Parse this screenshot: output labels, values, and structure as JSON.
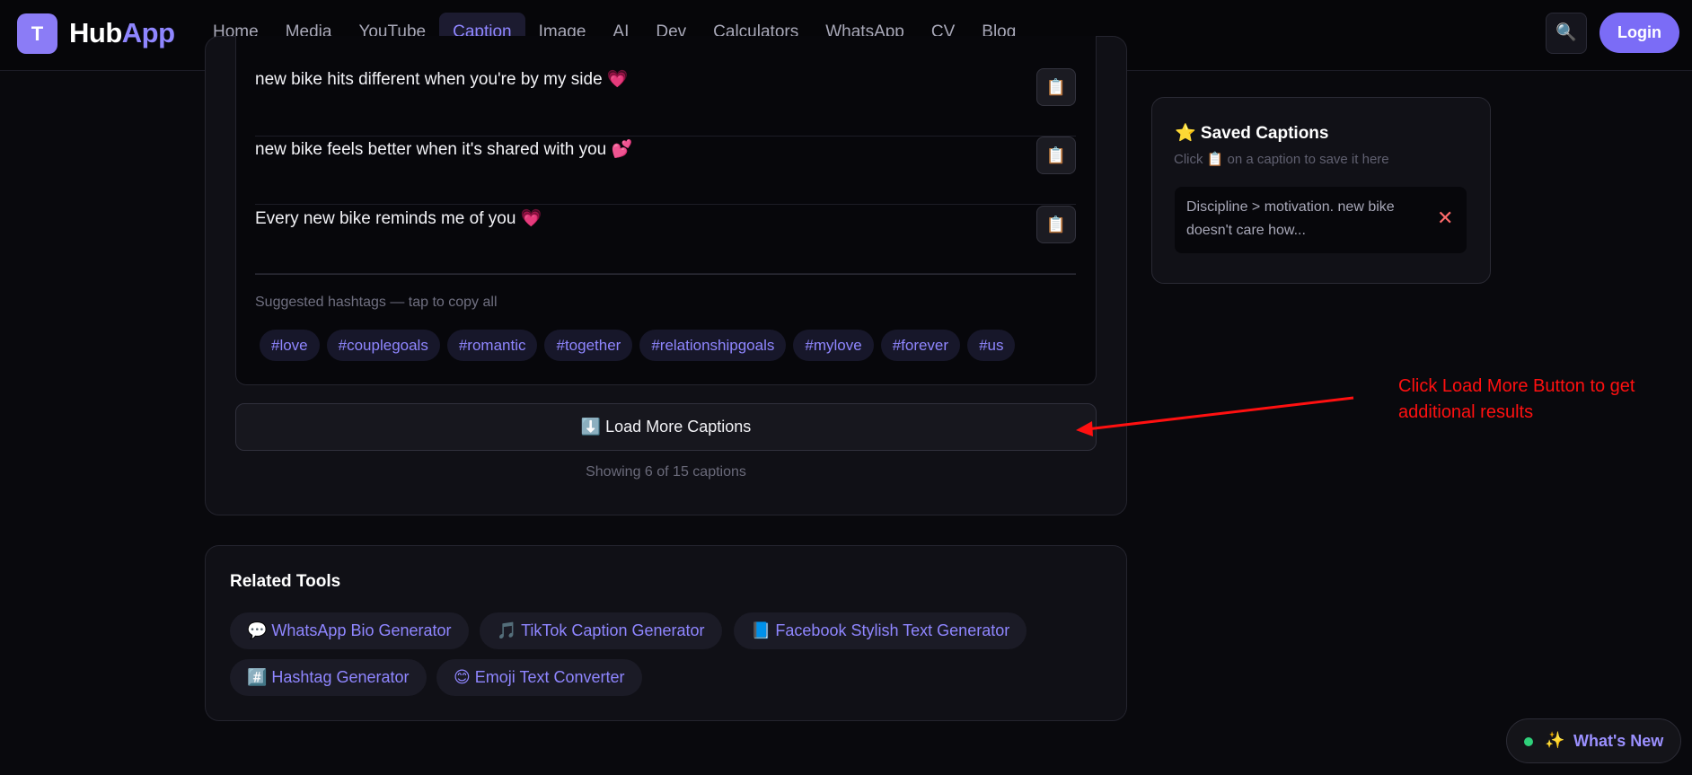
{
  "header": {
    "logo_letter": "T",
    "logo_hub": "Hub",
    "logo_app": "App",
    "nav": [
      "Home",
      "Media",
      "YouTube",
      "Caption",
      "Image",
      "AI",
      "Dev",
      "Calculators",
      "WhatsApp",
      "CV",
      "Blog"
    ],
    "active_nav": "Caption",
    "search_icon": "🔍",
    "login_label": "Login"
  },
  "captions": [
    {
      "text": "new bike hits different when you're by my side 💗"
    },
    {
      "text": "new bike feels better when it's shared with you 💕"
    },
    {
      "text": "Every new bike reminds me of you 💗"
    }
  ],
  "copy_icon": "📋",
  "hashtags": {
    "title": "Suggested hashtags — tap to copy all",
    "tags": [
      "#love",
      "#couplegoals",
      "#romantic",
      "#together",
      "#relationshipgoals",
      "#mylove",
      "#forever",
      "#us"
    ]
  },
  "load_more": {
    "label": "⬇️ Load More Captions",
    "showing": "Showing 6 of 15 captions"
  },
  "related": {
    "title": "Related Tools",
    "tools": [
      "💬 WhatsApp Bio Generator",
      "🎵 TikTok Caption Generator",
      "📘 Facebook Stylish Text Generator",
      "#️⃣ Hashtag Generator",
      "😊 Emoji Text Converter"
    ]
  },
  "saved": {
    "title": "⭐ Saved Captions",
    "subtitle": "Click 📋 on a caption to save it here",
    "items": [
      {
        "text": "Discipline > motivation. new bike doesn't care how..."
      }
    ],
    "remove_icon": "✕"
  },
  "annotation": {
    "text": "Click Load More Button to get additional results",
    "color": "#ff1010"
  },
  "whats_new": {
    "icon": "✨",
    "label": "What's New"
  }
}
